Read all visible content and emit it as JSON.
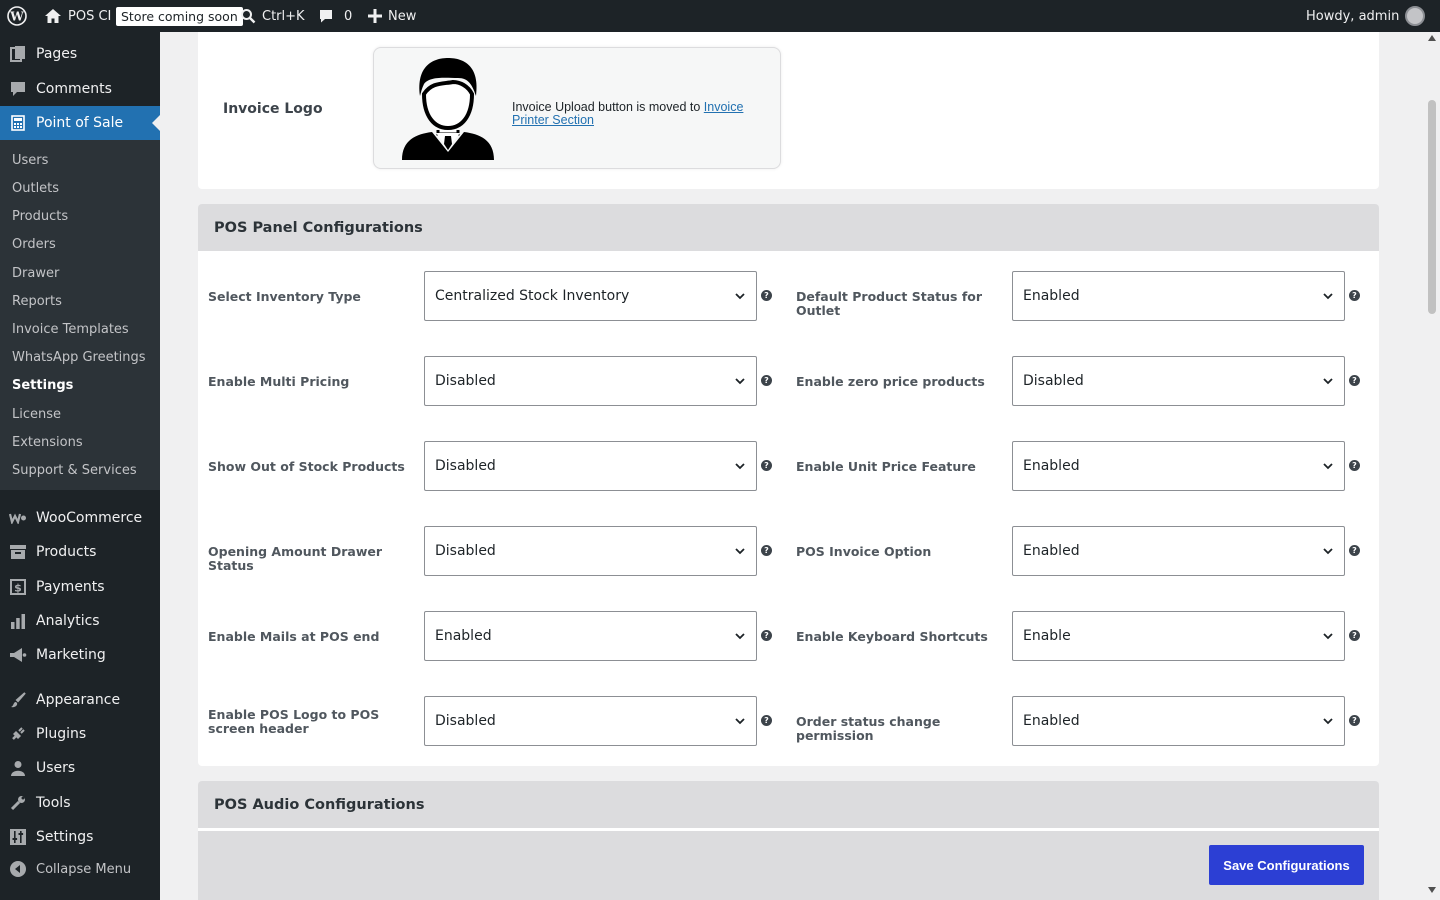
{
  "adminbar": {
    "site_name": "POS CI",
    "store_badge": "Store coming soon",
    "search_shortcut": "Ctrl+K",
    "comments_count": "0",
    "new_label": "New",
    "howdy": "Howdy, admin"
  },
  "sidebar": {
    "top_items": [
      "Pages",
      "Comments"
    ],
    "active": "Point of Sale",
    "submenu": [
      "Users",
      "Outlets",
      "Products",
      "Orders",
      "Drawer",
      "Reports",
      "Invoice Templates",
      "WhatsApp Greetings",
      "Settings",
      "License",
      "Extensions",
      "Support & Services"
    ],
    "current_submenu": "Settings",
    "bottom_items": [
      "WooCommerce",
      "Products",
      "Payments",
      "Analytics",
      "Marketing",
      "Appearance",
      "Plugins",
      "Users",
      "Tools",
      "Settings"
    ],
    "collapse": "Collapse Menu"
  },
  "invoice_logo": {
    "label": "Invoice Logo",
    "text": "Invoice Upload button is moved to",
    "link": "Invoice Printer Section"
  },
  "pos_panel": {
    "title": "POS Panel Configurations",
    "fields": [
      {
        "label": "Select Inventory Type",
        "value": "Centralized Stock Inventory"
      },
      {
        "label": "Default Product Status for Outlet",
        "value": "Enabled"
      },
      {
        "label": "Enable Multi Pricing",
        "value": "Disabled"
      },
      {
        "label": "Enable zero price products",
        "value": "Disabled"
      },
      {
        "label": "Show Out of Stock Products",
        "value": "Disabled"
      },
      {
        "label": "Enable Unit Price Feature",
        "value": "Enabled"
      },
      {
        "label": "Opening Amount Drawer Status",
        "value": "Disabled"
      },
      {
        "label": "POS Invoice Option",
        "value": "Enabled"
      },
      {
        "label": "Enable Mails at POS end",
        "value": "Enabled"
      },
      {
        "label": "Enable Keyboard Shortcuts",
        "value": "Enable"
      },
      {
        "label": "Enable POS Logo to POS screen header",
        "value": "Disabled"
      },
      {
        "label": "Order status change permission",
        "value": "Enabled"
      }
    ]
  },
  "audio": {
    "title": "POS Audio Configurations"
  },
  "save_button": "Save Configurations",
  "help_glyph": "?"
}
